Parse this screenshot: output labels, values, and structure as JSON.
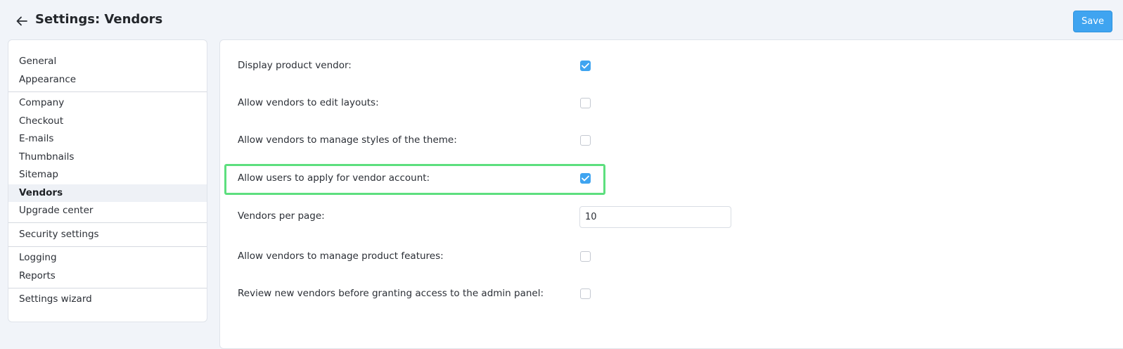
{
  "header": {
    "title": "Settings: Vendors",
    "back_icon": "arrow-left-icon",
    "save_label": "Save"
  },
  "colors": {
    "accent": "#3fa4f0",
    "highlight": "#5ddf7e",
    "background": "#f1f4f9"
  },
  "sidebar": {
    "groups": [
      [
        "General",
        "Appearance"
      ],
      [
        "Company",
        "Checkout",
        "E-mails",
        "Thumbnails",
        "Sitemap",
        "Vendors",
        "Upgrade center"
      ],
      [
        "Security settings"
      ],
      [
        "Logging",
        "Reports"
      ],
      [
        "Settings wizard"
      ]
    ],
    "active": "Vendors"
  },
  "settings": {
    "display_product_vendor": {
      "label": "Display product vendor:",
      "checked": true
    },
    "allow_edit_layouts": {
      "label": "Allow vendors to edit layouts:",
      "checked": false
    },
    "allow_manage_styles": {
      "label": "Allow vendors to manage styles of the theme:",
      "checked": false
    },
    "allow_apply_vendor_account": {
      "label": "Allow users to apply for vendor account:",
      "checked": true
    },
    "vendors_per_page": {
      "label": "Vendors per page:",
      "value": "10"
    },
    "allow_manage_features": {
      "label": "Allow vendors to manage product features:",
      "checked": false
    },
    "review_new_vendors": {
      "label": "Review new vendors before granting access to the admin panel:",
      "checked": false
    }
  }
}
